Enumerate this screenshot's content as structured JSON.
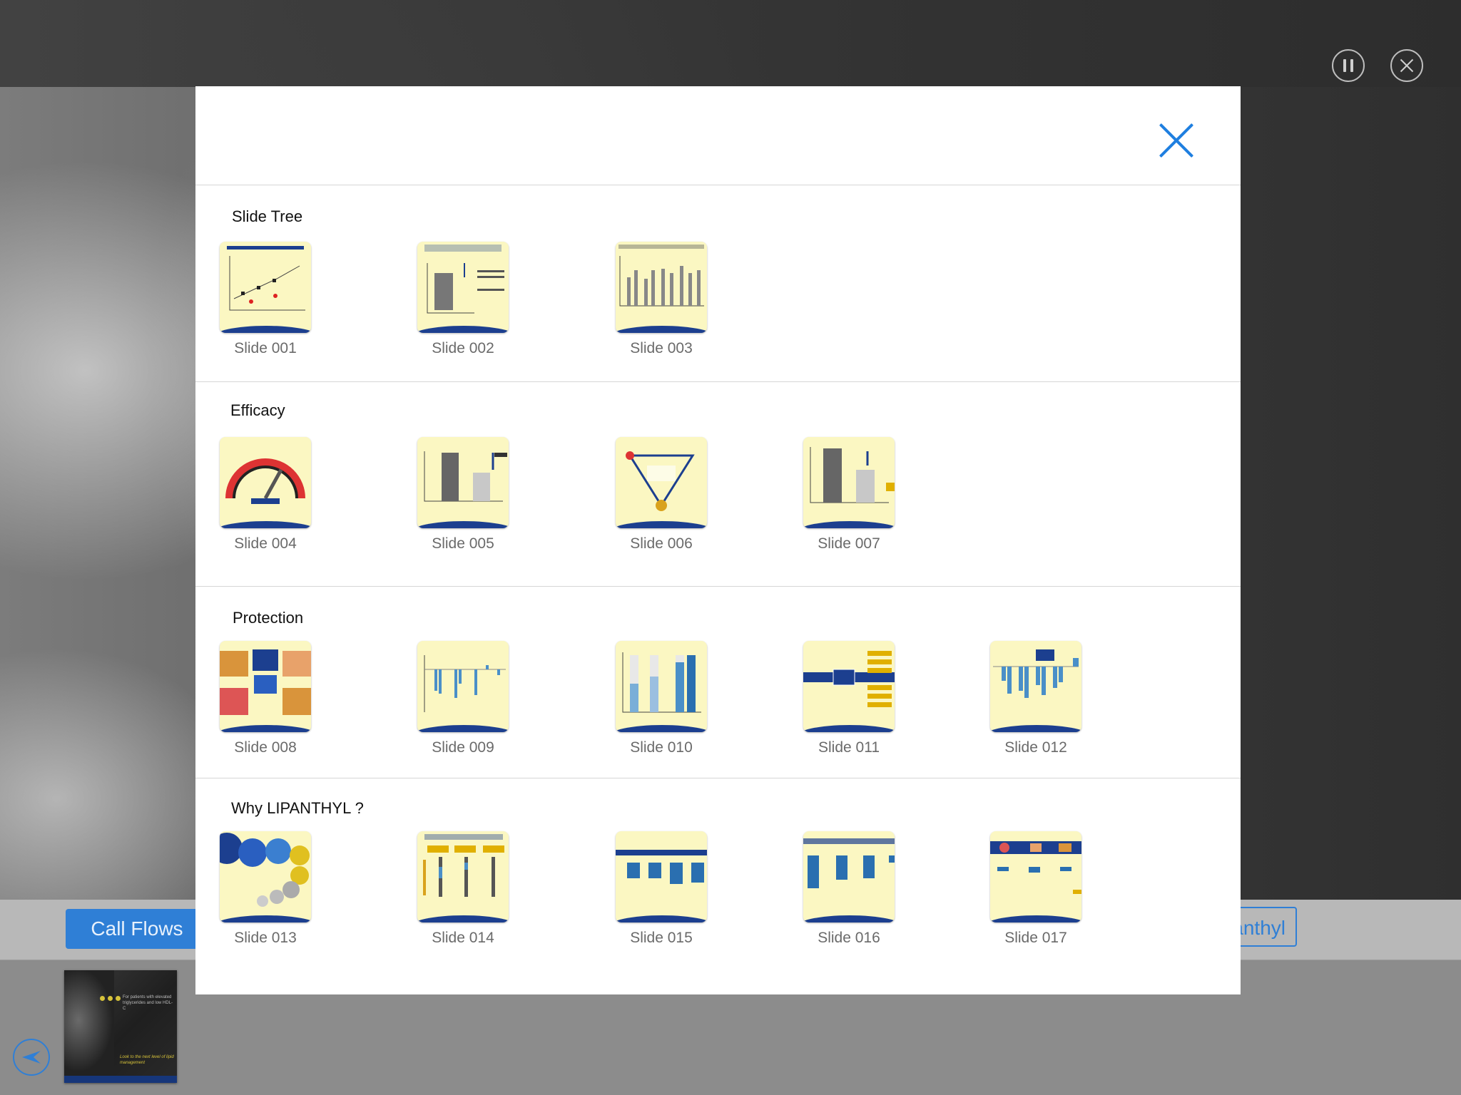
{
  "overlay_controls": {
    "pause_icon": "pause-icon",
    "close_icon": "close-icon"
  },
  "bottom_bar": {
    "call_flows_label": "Call Flows",
    "right_tab_label": "anthyl",
    "back_icon": "back-arrow-icon"
  },
  "tray_thumb": {
    "headline": "For patients with elevated triglycerides and low HDL-C",
    "tagline": "Look to the next level of lipid management"
  },
  "modal": {
    "close_icon": "close-icon",
    "sections": [
      {
        "title": "Slide Tree",
        "slides": [
          "Slide 001",
          "Slide 002",
          "Slide 003"
        ]
      },
      {
        "title": "Efficacy",
        "slides": [
          "Slide 004",
          "Slide 005",
          "Slide 006",
          "Slide 007"
        ]
      },
      {
        "title": "Protection",
        "slides": [
          "Slide 008",
          "Slide 009",
          "Slide 010",
          "Slide 011",
          "Slide 012"
        ]
      },
      {
        "title": "Why LIPANTHYL ?",
        "slides": [
          "Slide 013",
          "Slide 014",
          "Slide 015",
          "Slide 016",
          "Slide 017"
        ]
      }
    ]
  },
  "colors": {
    "accent": "#1f7fe0",
    "slide_bg": "#fbf7c2",
    "slide_band": "#1c3f8f"
  }
}
